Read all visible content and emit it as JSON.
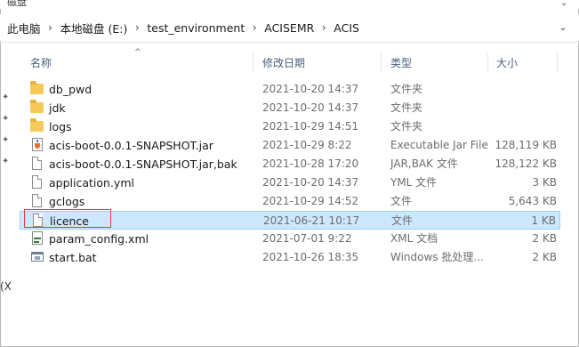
{
  "top": {
    "fragment": "磁盘"
  },
  "breadcrumbs": [
    "此电脑",
    "本地磁盘 (E:)",
    "test_environment",
    "ACISEMR",
    "ACIS"
  ],
  "columns": [
    "名称",
    "修改日期",
    "类型",
    "大小"
  ],
  "left_fragment": "(X",
  "files": [
    {
      "name": "db_pwd",
      "date": "2021-10-20 14:37",
      "type": "文件夹",
      "size": "",
      "icon": "folder-icon"
    },
    {
      "name": "jdk",
      "date": "2021-10-20 14:37",
      "type": "文件夹",
      "size": "",
      "icon": "folder-icon"
    },
    {
      "name": "logs",
      "date": "2021-10-29 14:51",
      "type": "文件夹",
      "size": "",
      "icon": "folder-icon"
    },
    {
      "name": "acis-boot-0.0.1-SNAPSHOT.jar",
      "date": "2021-10-29 8:22",
      "type": "Executable Jar File",
      "size": "128,119 KB",
      "icon": "jar-file-icon"
    },
    {
      "name": "acis-boot-0.0.1-SNAPSHOT.jar,bak",
      "date": "2021-10-28 17:20",
      "type": "JAR,BAK 文件",
      "size": "128,122 KB",
      "icon": "file-icon"
    },
    {
      "name": "application.yml",
      "date": "2021-10-20 14:37",
      "type": "YML 文件",
      "size": "3 KB",
      "icon": "file-icon"
    },
    {
      "name": "gclogs",
      "date": "2021-10-29 14:52",
      "type": "文件",
      "size": "5,643 KB",
      "icon": "file-icon"
    },
    {
      "name": "licence",
      "date": "2021-06-21 10:17",
      "type": "文件",
      "size": "1 KB",
      "icon": "file-icon",
      "selected": true
    },
    {
      "name": "param_config.xml",
      "date": "2021-07-01 9:22",
      "type": "XML 文档",
      "size": "2 KB",
      "icon": "xml-file-icon"
    },
    {
      "name": "start.bat",
      "date": "2021-10-26 18:35",
      "type": "Windows 批处理...",
      "size": "2 KB",
      "icon": "bat-file-icon"
    }
  ],
  "colors": {
    "selection": "#cce8ff",
    "selection_border": "#99d1ff",
    "highlight_box": "#e53935"
  }
}
